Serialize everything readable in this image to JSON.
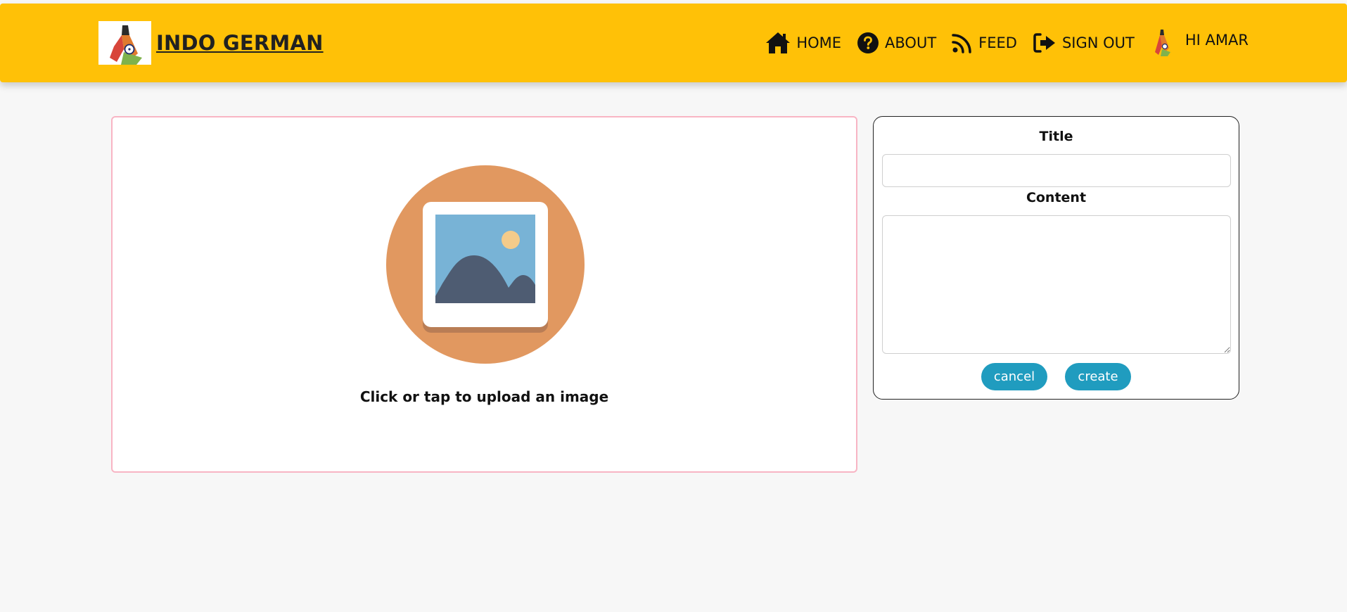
{
  "navbar": {
    "brand": "INDO GERMAN",
    "items": [
      {
        "label": "HOME",
        "icon": "home-icon"
      },
      {
        "label": "ABOUT",
        "icon": "question-circle-icon"
      },
      {
        "label": "FEED",
        "icon": "rss-feed-icon"
      },
      {
        "label": "SIGN OUT",
        "icon": "sign-out-icon"
      }
    ],
    "user_greeting": "HI AMAR"
  },
  "upload": {
    "prompt": "Click or tap to upload an image",
    "icon": "image-placeholder-icon"
  },
  "form": {
    "title_label": "Title",
    "title_value": "",
    "content_label": "Content",
    "content_value": "",
    "cancel_label": "cancel",
    "create_label": "create"
  },
  "colors": {
    "navbar": "#ffc107",
    "button": "#209cbf",
    "upload_border": "#f8b5c4",
    "background": "#f7f7f7"
  }
}
